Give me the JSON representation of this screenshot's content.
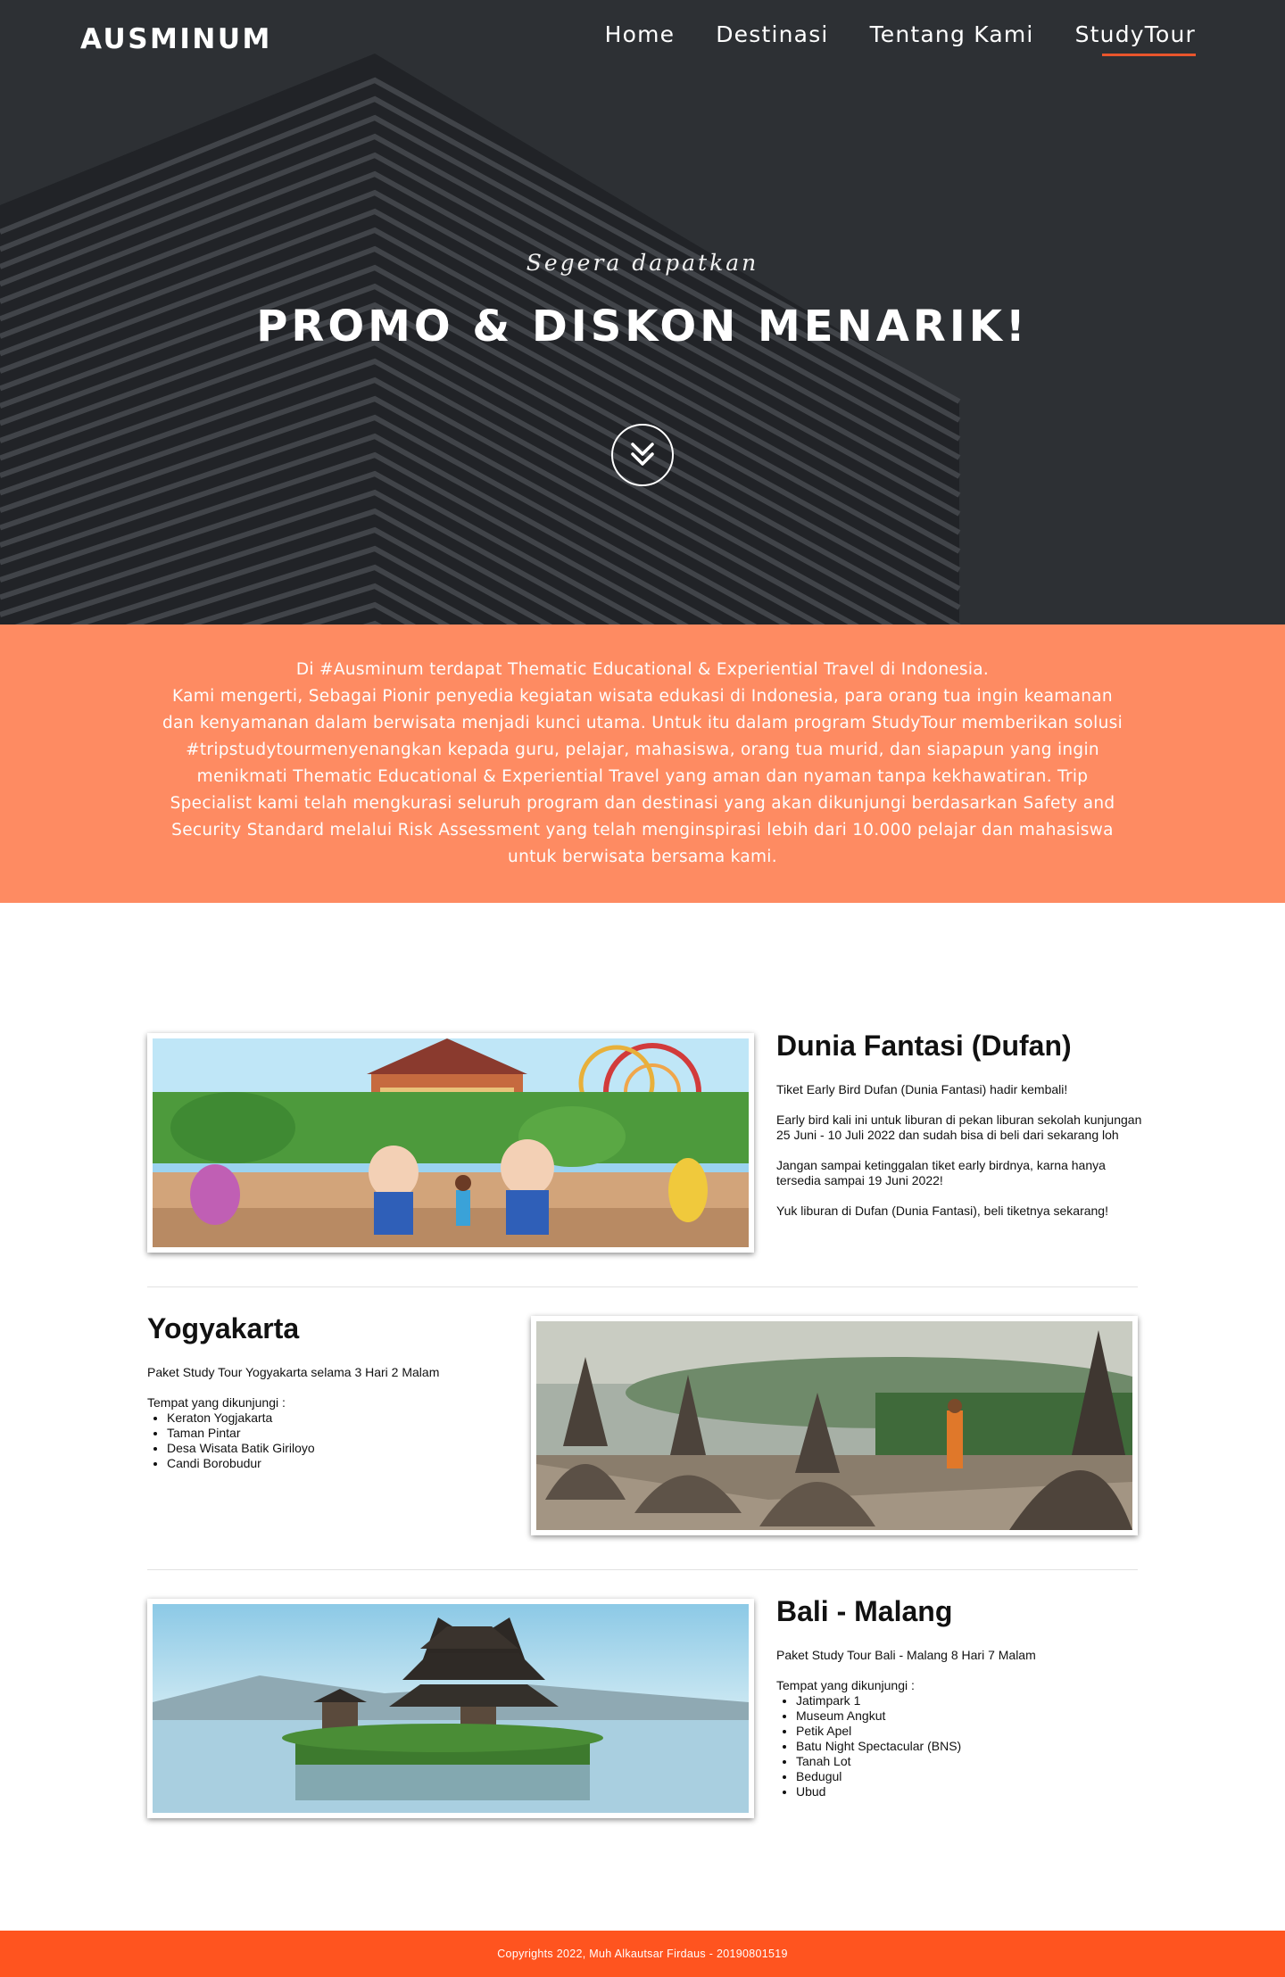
{
  "brand": "AUSMINUM",
  "nav": {
    "items": [
      {
        "label": "Home"
      },
      {
        "label": "Destinasi"
      },
      {
        "label": "Tentang Kami"
      },
      {
        "label": "StudyTour"
      }
    ],
    "active_index": 3
  },
  "hero": {
    "subtitle": "Segera dapatkan",
    "title": "PROMO & DISKON MENARIK!",
    "scroll_icon": "double-chevron-down-icon"
  },
  "about": {
    "lines": [
      "Di #Ausminum terdapat Thematic Educational & Experiential Travel di Indonesia.",
      "Kami mengerti, Sebagai Pionir penyedia kegiatan wisata edukasi di Indonesia, para orang tua ingin keamanan dan kenyamanan dalam berwisata menjadi kunci utama. Untuk itu dalam program StudyTour memberikan solusi #tripstudytourmenyenangkan kepada guru, pelajar, mahasiswa, orang tua murid, dan siapapun yang ingin menikmati Thematic Educational & Experiential Travel yang aman dan nyaman tanpa kekhawatiran. Trip Specialist kami telah mengkurasi seluruh program dan destinasi yang akan dikunjungi berdasarkan Safety and Security Standard melalui Risk Assessment yang telah menginspirasi lebih dari 10.000 pelajar dan mahasiswa untuk berwisata bersama kami."
    ]
  },
  "destinations": [
    {
      "title": "Dunia Fantasi (Dufan)",
      "paragraphs": [
        "Tiket Early Bird Dufan (Dunia Fantasi) hadir kembali!",
        "Early bird kali ini untuk liburan di pekan liburan sekolah kunjungan 25 Juni - 10 Juli 2022 dan sudah bisa di beli dari sekarang loh",
        "Jangan sampai ketinggalan tiket early birdnya, karna hanya tersedia sampai 19 Juni 2022!",
        "Yuk liburan di Dufan (Dunia Fantasi), beli tiketnya sekarang!"
      ]
    },
    {
      "title": "Yogyakarta",
      "intro": "Paket Study Tour Yogyakarta selama 3 Hari 2 Malam",
      "list_heading": "Tempat yang dikunjungi :",
      "places": [
        "Keraton Yogjakarta",
        "Taman Pintar",
        "Desa Wisata Batik Giriloyo",
        "Candi Borobudur"
      ]
    },
    {
      "title": "Bali - Malang",
      "intro": "Paket Study Tour Bali - Malang 8 Hari 7 Malam",
      "list_heading": "Tempat yang dikunjungi :",
      "places": [
        "Jatimpark 1",
        "Museum Angkut",
        "Petik Apel",
        "Batu Night Spectacular (BNS)",
        "Tanah Lot",
        "Bedugul",
        "Ubud"
      ]
    }
  ],
  "footer": {
    "text": "Copyrights 2022, Muh Alkautsar Firdaus - 20190801519"
  },
  "colors": {
    "hero_bg": "#2e3135",
    "about_bg": "#fe8b62",
    "nav_underline": "#e9552c",
    "footer_bg": "#ff541f"
  }
}
